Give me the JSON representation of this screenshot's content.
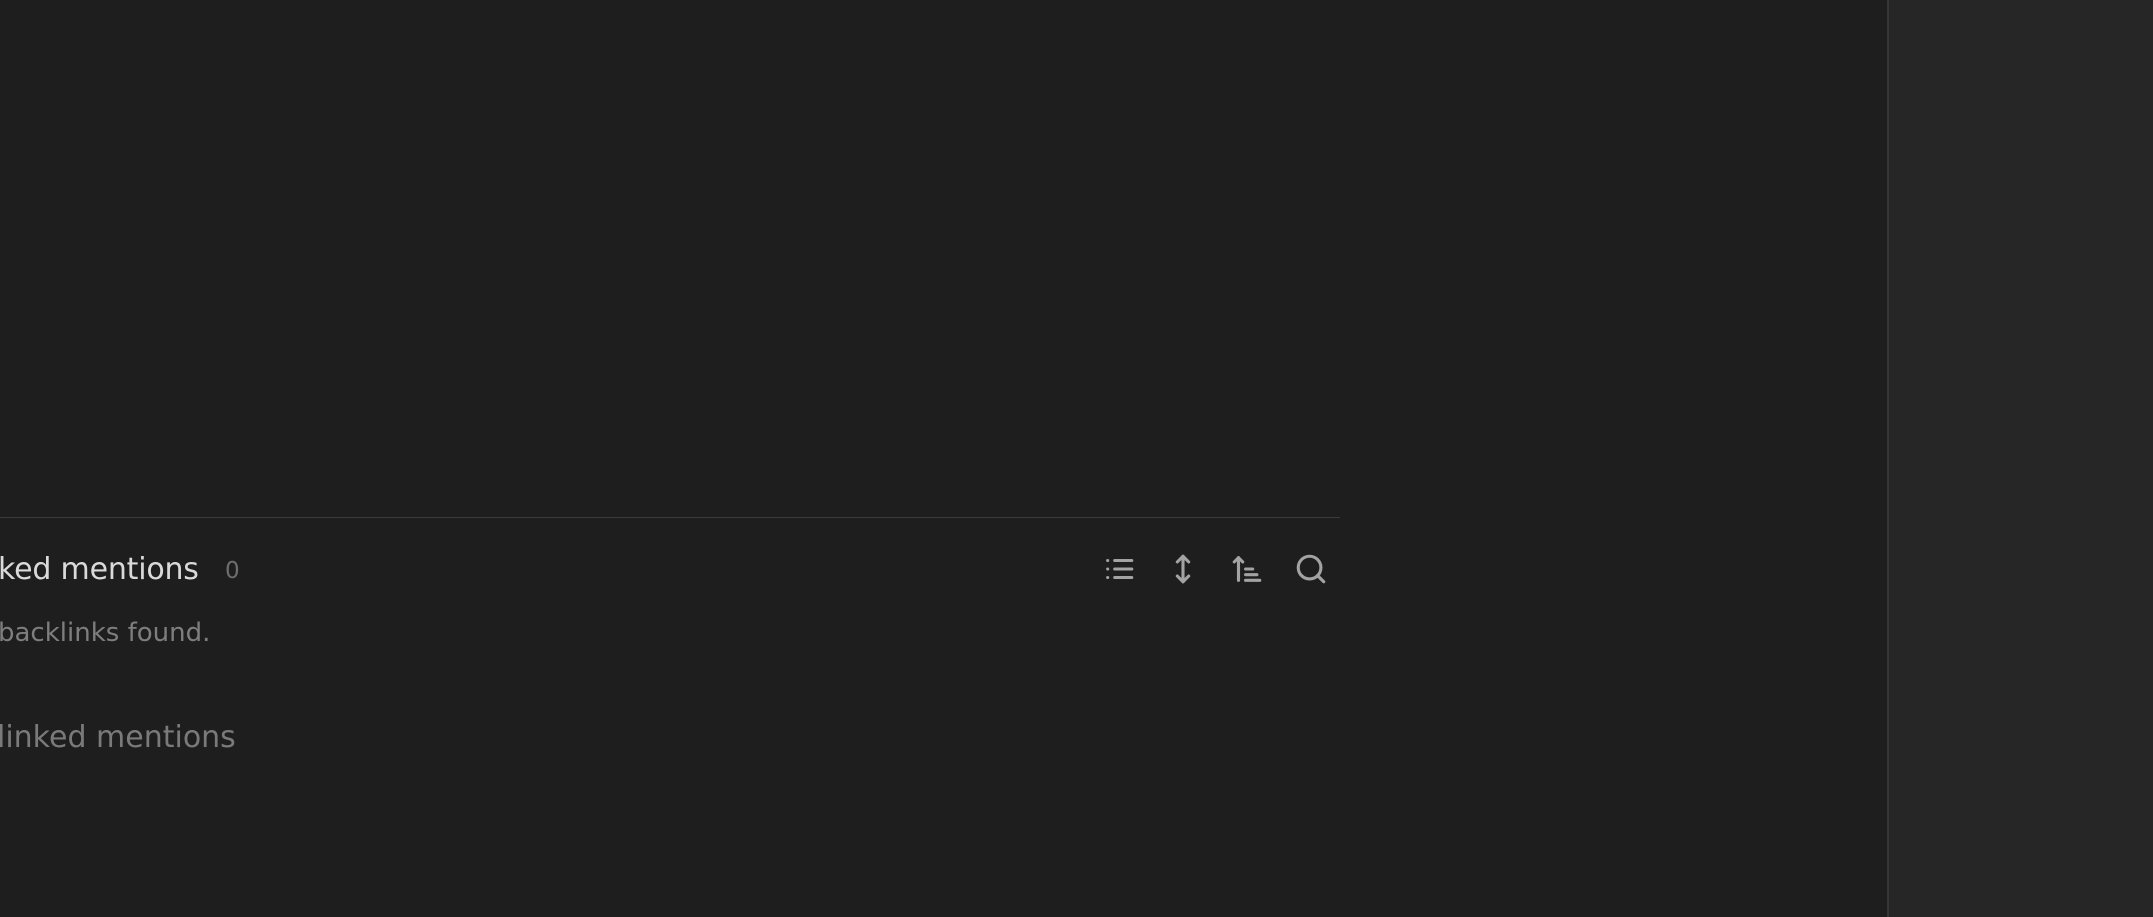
{
  "backlinks": {
    "linked_title": "ked mentions",
    "linked_count": "0",
    "empty_message": " backlinks found.",
    "unlinked_title": "linked mentions"
  },
  "toolbar": {
    "icons": [
      "list-icon",
      "expand-vertical-icon",
      "sort-icon",
      "search-icon"
    ]
  },
  "colors": {
    "editor_bg": "#1e1e1e",
    "sidebar_bg": "#262626",
    "divider": "#3a3a3a",
    "title_text": "#dadada",
    "muted_text": "#7e7e7e",
    "icon": "#a3a3a3"
  }
}
